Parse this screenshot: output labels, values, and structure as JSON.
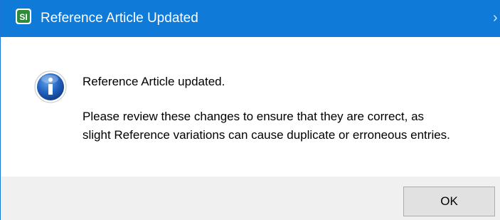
{
  "window": {
    "title": "Reference Article Updated",
    "app_icon": "si-logo-icon",
    "close_glyph": "›",
    "titlebar_color": "#0f7ad8"
  },
  "message": {
    "icon": "info-icon",
    "main": "Reference Article updated.",
    "detail_lines": [
      "Please review these changes to ensure that they are correct, as",
      "slight Reference variations can cause duplicate or erroneous entries."
    ]
  },
  "footer": {
    "ok_label": "OK"
  },
  "app_logo": {
    "letters": "SI"
  }
}
